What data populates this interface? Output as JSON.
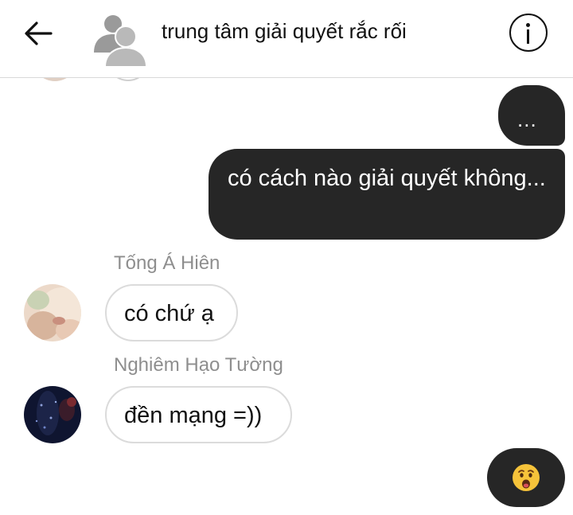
{
  "header": {
    "title": "trung tâm giải quyết rắc rối",
    "back_icon": "arrow-left-icon",
    "group_avatar_icon": "group-avatar-icon",
    "info_icon": "info-icon"
  },
  "messages": {
    "outgoing_1": "...",
    "outgoing_2": "có cách nào giải quyết không...",
    "incoming": [
      {
        "sender": "Tống Á Hiên",
        "text": "có chứ ạ"
      },
      {
        "sender": "Nghiêm Hạo Tường",
        "text": "đền mạng =))"
      }
    ],
    "outgoing_emoji": "anguished-face-emoji"
  },
  "colors": {
    "outgoing_bubble": "#262626",
    "incoming_border": "#dbdbdb",
    "sender_name": "#8e8e8e",
    "header_divider": "#d9d9d9"
  }
}
